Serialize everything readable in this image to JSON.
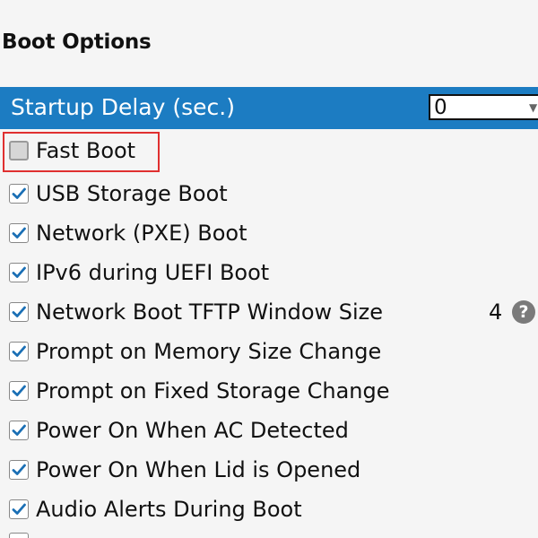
{
  "boot_options": {
    "title": "Boot Options",
    "startup_delay": {
      "label": "Startup Delay (sec.)",
      "value": "0"
    },
    "options": [
      {
        "label": "Fast Boot",
        "checked": false,
        "highlighted": true
      },
      {
        "label": "USB Storage Boot",
        "checked": true
      },
      {
        "label": "Network (PXE) Boot",
        "checked": true
      },
      {
        "label": "IPv6 during UEFI Boot",
        "checked": true
      },
      {
        "label": "Network Boot TFTP Window Size",
        "checked": true,
        "value": "4",
        "help_icon": "help-icon"
      },
      {
        "label": "Prompt on Memory Size Change",
        "checked": true
      },
      {
        "label": "Prompt on Fixed Storage Change",
        "checked": true
      },
      {
        "label": "Power On When AC Detected",
        "checked": true
      },
      {
        "label": "Power On When Lid is Opened",
        "checked": true
      },
      {
        "label": "Audio Alerts During Boot",
        "checked": true
      }
    ],
    "help_glyph": "?",
    "select_arrow_glyph": "▼",
    "colors": {
      "header_bar": "#1c7cc2",
      "highlight_border": "#e03030",
      "checkbox_check": "#1a6fb5"
    }
  }
}
